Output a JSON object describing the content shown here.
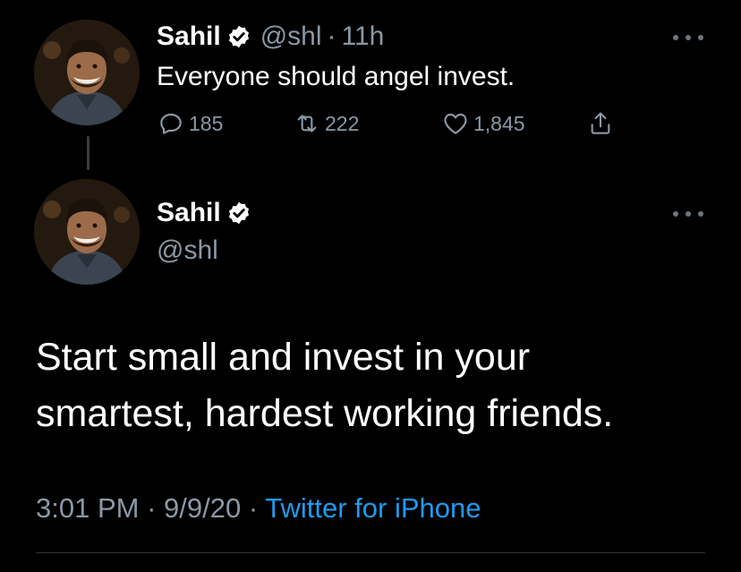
{
  "colors": {
    "background": "#000000",
    "text": "#ffffff",
    "muted": "#8b98a5",
    "link": "#1d9bf0",
    "divider": "#2f3336"
  },
  "parent_tweet": {
    "name": "Sahil",
    "verified_icon": "verified-badge-icon",
    "handle": "@shl",
    "separator": "·",
    "time_ago": "11h",
    "text": "Everyone should angel invest.",
    "actions": {
      "replies": "185",
      "retweets": "222",
      "likes": "1,845"
    }
  },
  "main_tweet": {
    "name": "Sahil",
    "verified_icon": "verified-badge-icon",
    "handle": "@shl",
    "text_line_1": "Start small and invest in your",
    "text_line_2": "smartest, hardest working friends.",
    "time": "3:01 PM",
    "separator": "·",
    "date": "9/9/20",
    "source": "Twitter for iPhone"
  }
}
